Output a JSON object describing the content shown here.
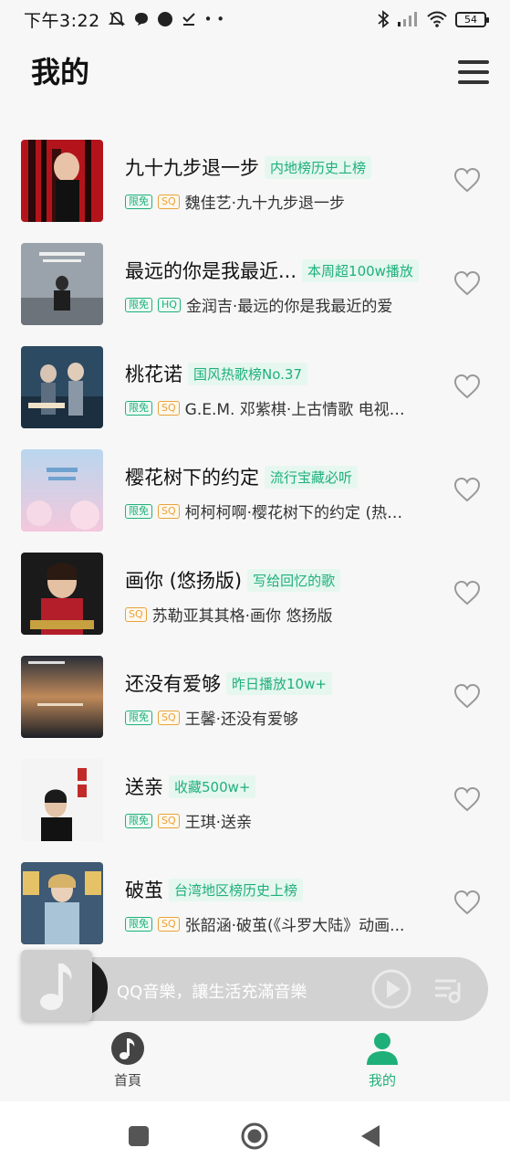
{
  "status_bar": {
    "time": "下午3:22",
    "battery": "54"
  },
  "header": {
    "title": "我的",
    "menu_icon": "hamburger-menu-icon"
  },
  "songs": [
    {
      "title": "九十九步退一步",
      "tag": "内地榜历史上榜",
      "badges": [
        "限免",
        "SQ"
      ],
      "artist": "魏佳艺·九十九步退一步"
    },
    {
      "title": "最远的你是我最近...",
      "tag": "本周超100w播放",
      "badges": [
        "限免",
        "HQ"
      ],
      "artist": "金润吉·最远的你是我最近的爱"
    },
    {
      "title": "桃花诺",
      "tag": "国风热歌榜No.37",
      "badges": [
        "限免",
        "SQ"
      ],
      "artist": "G.E.M. 邓紫棋·上古情歌 电视剧..."
    },
    {
      "title": "樱花树下的约定",
      "tag": "流行宝藏必听",
      "badges": [
        "限免",
        "SQ"
      ],
      "artist": "柯柯柯啊·樱花树下的约定 (热搜..."
    },
    {
      "title": "画你 (悠扬版)",
      "tag": "写给回忆的歌",
      "badges": [
        "SQ"
      ],
      "artist": "苏勒亚其其格·画你 悠扬版"
    },
    {
      "title": "还没有爱够",
      "tag": "昨日播放10w+",
      "badges": [
        "限免",
        "SQ"
      ],
      "artist": "王馨·还没有爱够"
    },
    {
      "title": "送亲",
      "tag": "收藏500w+",
      "badges": [
        "限免",
        "SQ"
      ],
      "artist": "王琪·送亲"
    },
    {
      "title": "破茧",
      "tag": "台湾地区榜历史上榜",
      "badges": [
        "限免",
        "SQ"
      ],
      "artist": "张韶涵·破茧(《斗罗大陆》动画..."
    }
  ],
  "mini_player": {
    "text": "QQ音樂，讓生活充滿音樂"
  },
  "tabs": [
    {
      "label": "首頁",
      "icon": "music-note-icon",
      "active": false
    },
    {
      "label": "我的",
      "icon": "user-icon",
      "active": true
    }
  ],
  "colors": {
    "accent": "#1fb07a",
    "sq_badge": "#e8a23b"
  }
}
